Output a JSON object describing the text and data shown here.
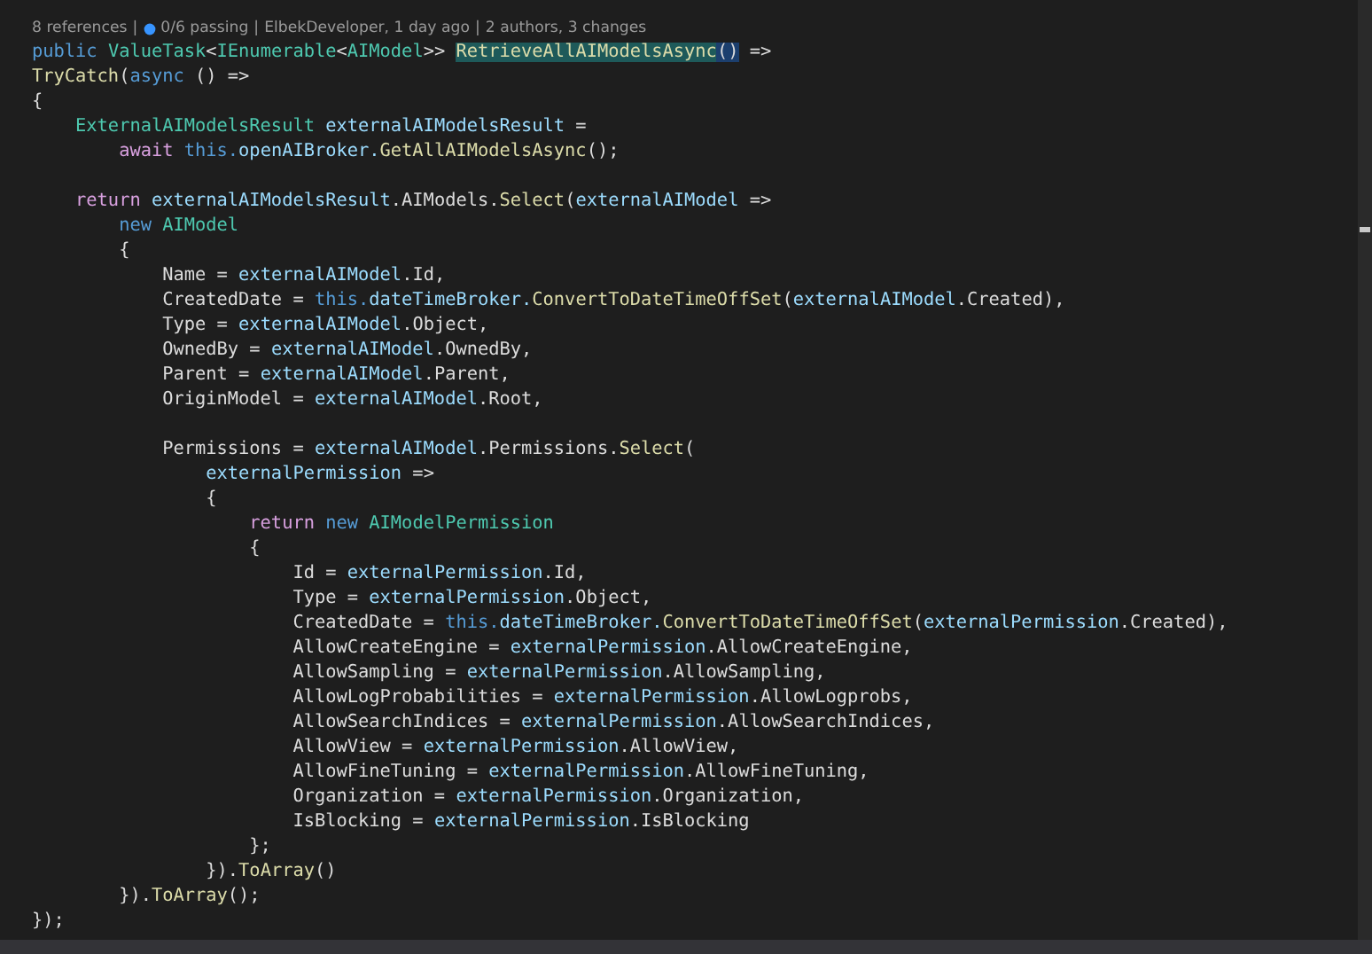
{
  "codelens": {
    "separator": "|",
    "items": [
      {
        "text": "8 references",
        "icon": false
      },
      {
        "text": "0/6 passing",
        "icon": true
      },
      {
        "text": "ElbekDeveloper, 1 day ago",
        "icon": false
      },
      {
        "text": "2 authors, 3 changes",
        "icon": false
      }
    ]
  },
  "editor": {
    "lines": [
      {
        "kind": "code",
        "tokens": [
          {
            "kind": "keyword",
            "text": "public "
          },
          {
            "kind": "type",
            "text": "ValueTask"
          },
          {
            "kind": "plain",
            "text": "<"
          },
          {
            "kind": "type",
            "text": "IEnumerable"
          },
          {
            "kind": "plain",
            "text": "<"
          },
          {
            "kind": "type",
            "text": "AIModel"
          },
          {
            "kind": "plain",
            "text": ">> "
          },
          {
            "kind": "match",
            "text": "RetrieveAllAIModelsAsync"
          },
          {
            "kind": "brace",
            "text": "()"
          },
          {
            "kind": "plain",
            "text": " =>"
          }
        ]
      },
      {
        "kind": "code",
        "tokens": [
          {
            "kind": "method",
            "text": "TryCatch"
          },
          {
            "kind": "plain",
            "text": "("
          },
          {
            "kind": "keyword",
            "text": "async"
          },
          {
            "kind": "plain",
            "text": " () =>"
          }
        ]
      },
      {
        "kind": "code",
        "tokens": [
          {
            "kind": "plain",
            "text": "{"
          }
        ]
      },
      {
        "kind": "code",
        "tokens": [
          {
            "kind": "type",
            "text": "    ExternalAIModelsResult "
          },
          {
            "kind": "variable",
            "text": "externalAIModelsResult"
          },
          {
            "kind": "plain",
            "text": " ="
          }
        ]
      },
      {
        "kind": "code",
        "tokens": [
          {
            "kind": "control",
            "text": "        await "
          },
          {
            "kind": "keyword",
            "text": "this."
          },
          {
            "kind": "variable",
            "text": "openAIBroker."
          },
          {
            "kind": "method",
            "text": "GetAllAIModelsAsync"
          },
          {
            "kind": "plain",
            "text": "();"
          }
        ]
      },
      {
        "kind": "blank"
      },
      {
        "kind": "code",
        "tokens": [
          {
            "kind": "control",
            "text": "    return "
          },
          {
            "kind": "variable",
            "text": "externalAIModelsResult"
          },
          {
            "kind": "plain",
            "text": ".AIModels."
          },
          {
            "kind": "method",
            "text": "Select"
          },
          {
            "kind": "plain",
            "text": "("
          },
          {
            "kind": "variable",
            "text": "externalAIModel"
          },
          {
            "kind": "plain",
            "text": " =>"
          }
        ]
      },
      {
        "kind": "code",
        "tokens": [
          {
            "kind": "keyword",
            "text": "        new "
          },
          {
            "kind": "type",
            "text": "AIModel"
          }
        ]
      },
      {
        "kind": "code",
        "tokens": [
          {
            "kind": "plain",
            "text": "        {"
          }
        ]
      },
      {
        "kind": "code",
        "tokens": [
          {
            "kind": "plain",
            "text": "            Name = "
          },
          {
            "kind": "variable",
            "text": "externalAIModel"
          },
          {
            "kind": "plain",
            "text": ".Id,"
          }
        ]
      },
      {
        "kind": "code",
        "tokens": [
          {
            "kind": "plain",
            "text": "            CreatedDate = "
          },
          {
            "kind": "keyword",
            "text": "this."
          },
          {
            "kind": "variable",
            "text": "dateTimeBroker."
          },
          {
            "kind": "method",
            "text": "ConvertToDateTimeOffSet"
          },
          {
            "kind": "plain",
            "text": "("
          },
          {
            "kind": "variable",
            "text": "externalAIModel"
          },
          {
            "kind": "plain",
            "text": ".Created),"
          }
        ]
      },
      {
        "kind": "code",
        "tokens": [
          {
            "kind": "plain",
            "text": "            Type = "
          },
          {
            "kind": "variable",
            "text": "externalAIModel"
          },
          {
            "kind": "plain",
            "text": ".Object,"
          }
        ]
      },
      {
        "kind": "code",
        "tokens": [
          {
            "kind": "plain",
            "text": "            OwnedBy = "
          },
          {
            "kind": "variable",
            "text": "externalAIModel"
          },
          {
            "kind": "plain",
            "text": ".OwnedBy,"
          }
        ]
      },
      {
        "kind": "code",
        "tokens": [
          {
            "kind": "plain",
            "text": "            Parent = "
          },
          {
            "kind": "variable",
            "text": "externalAIModel"
          },
          {
            "kind": "plain",
            "text": ".Parent,"
          }
        ]
      },
      {
        "kind": "code",
        "tokens": [
          {
            "kind": "plain",
            "text": "            OriginModel = "
          },
          {
            "kind": "variable",
            "text": "externalAIModel"
          },
          {
            "kind": "plain",
            "text": ".Root,"
          }
        ]
      },
      {
        "kind": "blank"
      },
      {
        "kind": "code",
        "tokens": [
          {
            "kind": "plain",
            "text": "            Permissions = "
          },
          {
            "kind": "variable",
            "text": "externalAIModel"
          },
          {
            "kind": "plain",
            "text": ".Permissions."
          },
          {
            "kind": "method",
            "text": "Select"
          },
          {
            "kind": "plain",
            "text": "("
          }
        ]
      },
      {
        "kind": "code",
        "tokens": [
          {
            "kind": "variable",
            "text": "                externalPermission"
          },
          {
            "kind": "plain",
            "text": " =>"
          }
        ]
      },
      {
        "kind": "code",
        "tokens": [
          {
            "kind": "plain",
            "text": "                {"
          }
        ]
      },
      {
        "kind": "code",
        "tokens": [
          {
            "kind": "control",
            "text": "                    return "
          },
          {
            "kind": "keyword",
            "text": "new "
          },
          {
            "kind": "type",
            "text": "AIModelPermission"
          }
        ]
      },
      {
        "kind": "code",
        "tokens": [
          {
            "kind": "plain",
            "text": "                    {"
          }
        ]
      },
      {
        "kind": "code",
        "tokens": [
          {
            "kind": "plain",
            "text": "                        Id = "
          },
          {
            "kind": "variable",
            "text": "externalPermission"
          },
          {
            "kind": "plain",
            "text": ".Id,"
          }
        ]
      },
      {
        "kind": "code",
        "tokens": [
          {
            "kind": "plain",
            "text": "                        Type = "
          },
          {
            "kind": "variable",
            "text": "externalPermission"
          },
          {
            "kind": "plain",
            "text": ".Object,"
          }
        ]
      },
      {
        "kind": "code",
        "tokens": [
          {
            "kind": "plain",
            "text": "                        CreatedDate = "
          },
          {
            "kind": "keyword",
            "text": "this."
          },
          {
            "kind": "variable",
            "text": "dateTimeBroker."
          },
          {
            "kind": "method",
            "text": "ConvertToDateTimeOffSet"
          },
          {
            "kind": "plain",
            "text": "("
          },
          {
            "kind": "variable",
            "text": "externalPermission"
          },
          {
            "kind": "plain",
            "text": ".Created),"
          }
        ]
      },
      {
        "kind": "code",
        "tokens": [
          {
            "kind": "plain",
            "text": "                        AllowCreateEngine = "
          },
          {
            "kind": "variable",
            "text": "externalPermission"
          },
          {
            "kind": "plain",
            "text": ".AllowCreateEngine,"
          }
        ]
      },
      {
        "kind": "code",
        "tokens": [
          {
            "kind": "plain",
            "text": "                        AllowSampling = "
          },
          {
            "kind": "variable",
            "text": "externalPermission"
          },
          {
            "kind": "plain",
            "text": ".AllowSampling,"
          }
        ]
      },
      {
        "kind": "code",
        "tokens": [
          {
            "kind": "plain",
            "text": "                        AllowLogProbabilities = "
          },
          {
            "kind": "variable",
            "text": "externalPermission"
          },
          {
            "kind": "plain",
            "text": ".AllowLogprobs,"
          }
        ]
      },
      {
        "kind": "code",
        "tokens": [
          {
            "kind": "plain",
            "text": "                        AllowSearchIndices = "
          },
          {
            "kind": "variable",
            "text": "externalPermission"
          },
          {
            "kind": "plain",
            "text": ".AllowSearchIndices,"
          }
        ]
      },
      {
        "kind": "code",
        "tokens": [
          {
            "kind": "plain",
            "text": "                        AllowView = "
          },
          {
            "kind": "variable",
            "text": "externalPermission"
          },
          {
            "kind": "plain",
            "text": ".AllowView,"
          }
        ]
      },
      {
        "kind": "code",
        "tokens": [
          {
            "kind": "plain",
            "text": "                        AllowFineTuning = "
          },
          {
            "kind": "variable",
            "text": "externalPermission"
          },
          {
            "kind": "plain",
            "text": ".AllowFineTuning,"
          }
        ]
      },
      {
        "kind": "code",
        "tokens": [
          {
            "kind": "plain",
            "text": "                        Organization = "
          },
          {
            "kind": "variable",
            "text": "externalPermission"
          },
          {
            "kind": "plain",
            "text": ".Organization,"
          }
        ]
      },
      {
        "kind": "code",
        "tokens": [
          {
            "kind": "plain",
            "text": "                        IsBlocking = "
          },
          {
            "kind": "variable",
            "text": "externalPermission"
          },
          {
            "kind": "plain",
            "text": ".IsBlocking"
          }
        ]
      },
      {
        "kind": "code",
        "tokens": [
          {
            "kind": "plain",
            "text": "                    };"
          }
        ]
      },
      {
        "kind": "code",
        "tokens": [
          {
            "kind": "plain",
            "text": "                })."
          },
          {
            "kind": "method",
            "text": "ToArray"
          },
          {
            "kind": "plain",
            "text": "()"
          }
        ]
      },
      {
        "kind": "code",
        "tokens": [
          {
            "kind": "plain",
            "text": "        })."
          },
          {
            "kind": "method",
            "text": "ToArray"
          },
          {
            "kind": "plain",
            "text": "();"
          }
        ]
      },
      {
        "kind": "code",
        "tokens": [
          {
            "kind": "plain",
            "text": "});"
          }
        ]
      }
    ]
  }
}
